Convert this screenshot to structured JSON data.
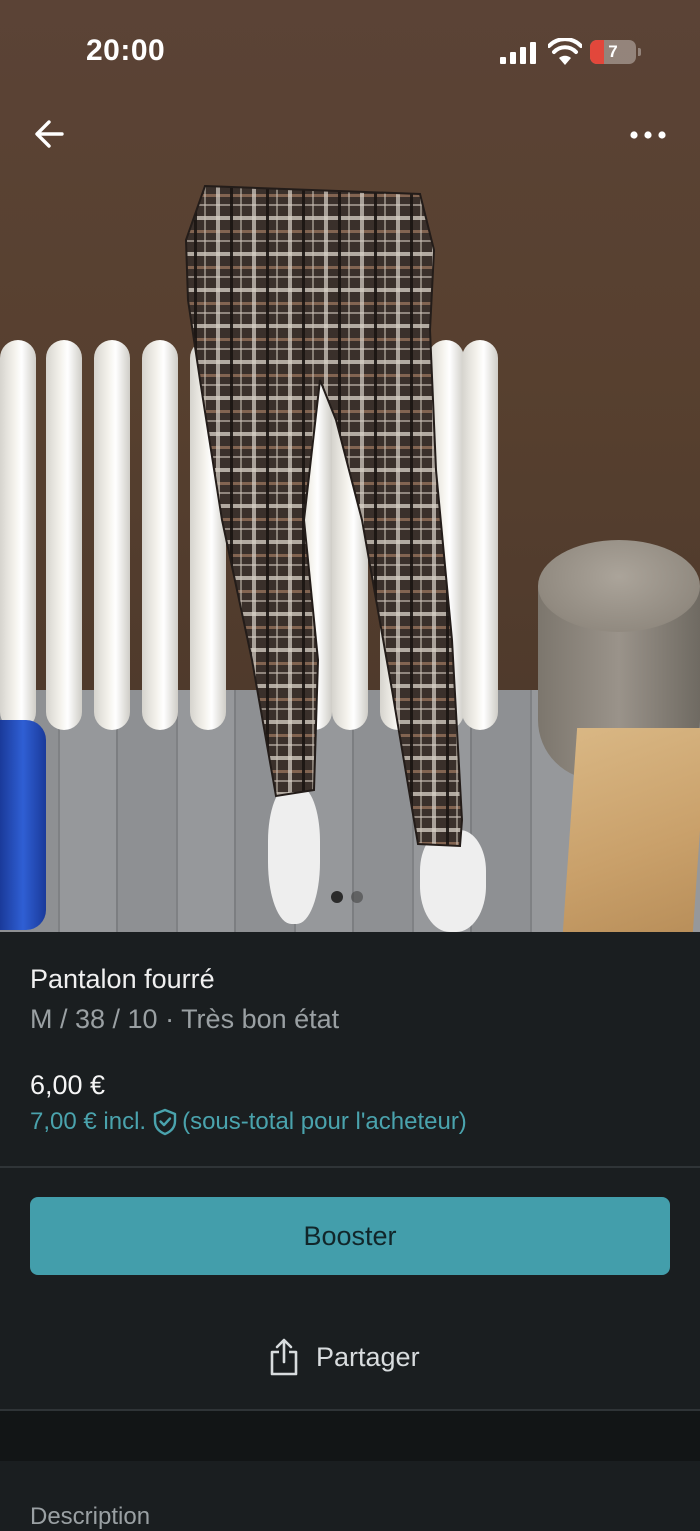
{
  "status_bar": {
    "time": "20:00",
    "battery": "7"
  },
  "photo": {
    "carousel_total": 2,
    "carousel_active": 1
  },
  "item": {
    "title": "Pantalon fourré",
    "meta": "M / 38 / 10 · Très bon état",
    "price": "6,00 €",
    "price_incl": "7,00 € incl.",
    "price_incl_note": "(sous-total pour l'acheteur)"
  },
  "actions": {
    "booster_label": "Booster",
    "share_label": "Partager"
  },
  "sections": {
    "description_label": "Description"
  },
  "colors": {
    "accent": "#439eab",
    "link": "#4aa3ad",
    "background": "#1a1e20"
  },
  "icons": {
    "back": "arrow-left-icon",
    "more": "more-horizontal-icon",
    "share": "share-icon",
    "shield": "shield-check-icon"
  }
}
